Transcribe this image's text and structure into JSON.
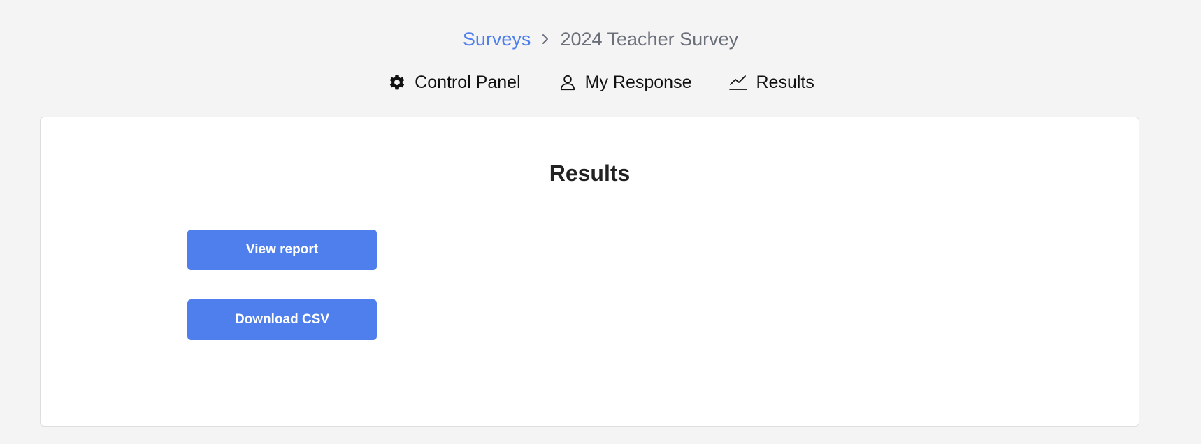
{
  "breadcrumb": {
    "parent": "Surveys",
    "separator_icon": "chevron-right-icon",
    "current": "2024 Teacher Survey"
  },
  "nav": {
    "items": [
      {
        "label": "Control Panel",
        "icon": "gear-icon"
      },
      {
        "label": "My Response",
        "icon": "user-icon"
      },
      {
        "label": "Results",
        "icon": "line-chart-icon"
      }
    ]
  },
  "results": {
    "title": "Results",
    "view_report_label": "View report",
    "download_csv_label": "Download CSV"
  },
  "colors": {
    "accent": "#4f7fec",
    "background": "#f4f4f4",
    "card": "#ffffff",
    "muted_text": "#6b6f7a"
  }
}
